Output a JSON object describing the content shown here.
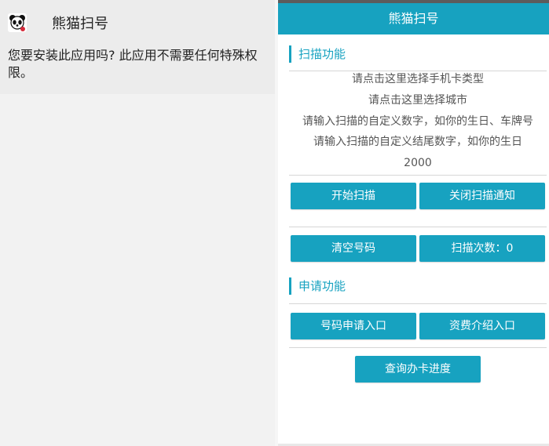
{
  "install_dialog": {
    "app_name": "熊猫扫号",
    "message": "您要安装此应用吗? 此应用不需要任何特殊权限。"
  },
  "app": {
    "title": "熊猫扫号",
    "accent_color": "#17a2c0",
    "scan_section": {
      "heading": "扫描功能",
      "options": [
        "请点击这里选择手机卡类型",
        "请点击这里选择城市",
        "请输入扫描的自定义数字，如你的生日、车牌号",
        "请输入扫描的自定义结尾数字，如你的生日",
        "2000"
      ],
      "buttons": {
        "start_scan": "开始扫描",
        "close_notify": "关闭扫描通知",
        "clear_numbers": "清空号码",
        "scan_count": "扫描次数：0"
      }
    },
    "apply_section": {
      "heading": "申请功能",
      "buttons": {
        "number_apply": "号码申请入口",
        "tariff_intro": "资费介绍入口",
        "query_progress": "查询办卡进度"
      }
    }
  }
}
